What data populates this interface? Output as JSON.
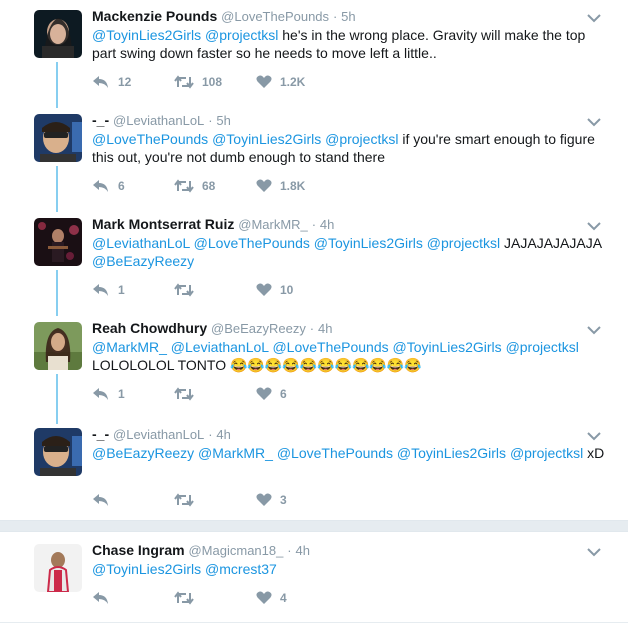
{
  "colors": {
    "mention": "#1b95e0",
    "meta": "#8899a6",
    "thread_line": "#87cef0"
  },
  "tweets": [
    {
      "name": "Mackenzie Pounds",
      "handle": "@LoveThePounds",
      "dot": "·",
      "time": "5h",
      "text_parts": [
        {
          "t": "@ToyinLies2Girls",
          "m": true
        },
        {
          "t": " ",
          "m": false
        },
        {
          "t": "@projectksl",
          "m": true
        },
        {
          "t": "  he's in the wrong place. Gravity will make the top part swing down faster so he needs to move left a little..",
          "m": false
        }
      ],
      "replies": "12",
      "retweets": "108",
      "likes": "1.2K",
      "avatar_icon": "user-avatar-icon"
    },
    {
      "name": "-_-",
      "handle": "@LeviathanLoL",
      "dot": "·",
      "time": "5h",
      "text_parts": [
        {
          "t": "@LoveThePounds",
          "m": true
        },
        {
          "t": " ",
          "m": false
        },
        {
          "t": "@ToyinLies2Girls",
          "m": true
        },
        {
          "t": " ",
          "m": false
        },
        {
          "t": "@projectksl",
          "m": true
        },
        {
          "t": " if you're smart enough to figure this out, you're not dumb enough to stand there",
          "m": false
        }
      ],
      "replies": "6",
      "retweets": "68",
      "likes": "1.8K",
      "avatar_icon": "user-avatar-icon"
    },
    {
      "name": "Mark Montserrat Ruiz",
      "handle": "@MarkMR_",
      "dot": "·",
      "time": "4h",
      "text_parts": [
        {
          "t": "@LeviathanLoL",
          "m": true
        },
        {
          "t": " ",
          "m": false
        },
        {
          "t": "@LoveThePounds",
          "m": true
        },
        {
          "t": " ",
          "m": false
        },
        {
          "t": "@ToyinLies2Girls",
          "m": true
        },
        {
          "t": " ",
          "m": false
        },
        {
          "t": "@projectksl",
          "m": true
        },
        {
          "t": " JAJAJAJAJAJA ",
          "m": false
        },
        {
          "t": "@BeEazyReezy",
          "m": true
        }
      ],
      "replies": "1",
      "retweets": "",
      "likes": "10",
      "avatar_icon": "user-avatar-icon"
    },
    {
      "name": "Reah Chowdhury",
      "handle": "@BeEazyReezy",
      "dot": "·",
      "time": "4h",
      "text_parts": [
        {
          "t": "@MarkMR_",
          "m": true
        },
        {
          "t": " ",
          "m": false
        },
        {
          "t": "@LeviathanLoL",
          "m": true
        },
        {
          "t": " ",
          "m": false
        },
        {
          "t": "@LoveThePounds",
          "m": true
        },
        {
          "t": " ",
          "m": false
        },
        {
          "t": "@ToyinLies2Girls",
          "m": true
        },
        {
          "t": " ",
          "m": false
        },
        {
          "t": "@projectksl",
          "m": true
        },
        {
          "t": " LOLOLOLOL TONTO 😂😂😂😂😂😂😂😂😂😂😂",
          "m": false
        }
      ],
      "replies": "1",
      "retweets": "",
      "likes": "6",
      "avatar_icon": "user-avatar-icon"
    },
    {
      "name": "-_-",
      "handle": "@LeviathanLoL",
      "dot": "·",
      "time": "4h",
      "text_parts": [
        {
          "t": "@BeEazyReezy",
          "m": true
        },
        {
          "t": " ",
          "m": false
        },
        {
          "t": "@MarkMR_",
          "m": true
        },
        {
          "t": " ",
          "m": false
        },
        {
          "t": "@LoveThePounds",
          "m": true
        },
        {
          "t": " ",
          "m": false
        },
        {
          "t": "@ToyinLies2Girls",
          "m": true
        },
        {
          "t": " ",
          "m": false
        },
        {
          "t": "@projectksl",
          "m": true
        },
        {
          "t": " xD",
          "m": false
        }
      ],
      "replies": "",
      "retweets": "",
      "likes": "3",
      "avatar_icon": "user-avatar-icon"
    },
    {
      "name": "Chase Ingram",
      "handle": "@Magicman18_",
      "dot": "·",
      "time": "4h",
      "text_parts": [
        {
          "t": "@ToyinLies2Girls",
          "m": true
        },
        {
          "t": " ",
          "m": false
        },
        {
          "t": "@mcrest37",
          "m": true
        }
      ],
      "replies": "",
      "retweets": "",
      "likes": "4",
      "avatar_icon": "user-avatar-icon"
    }
  ]
}
